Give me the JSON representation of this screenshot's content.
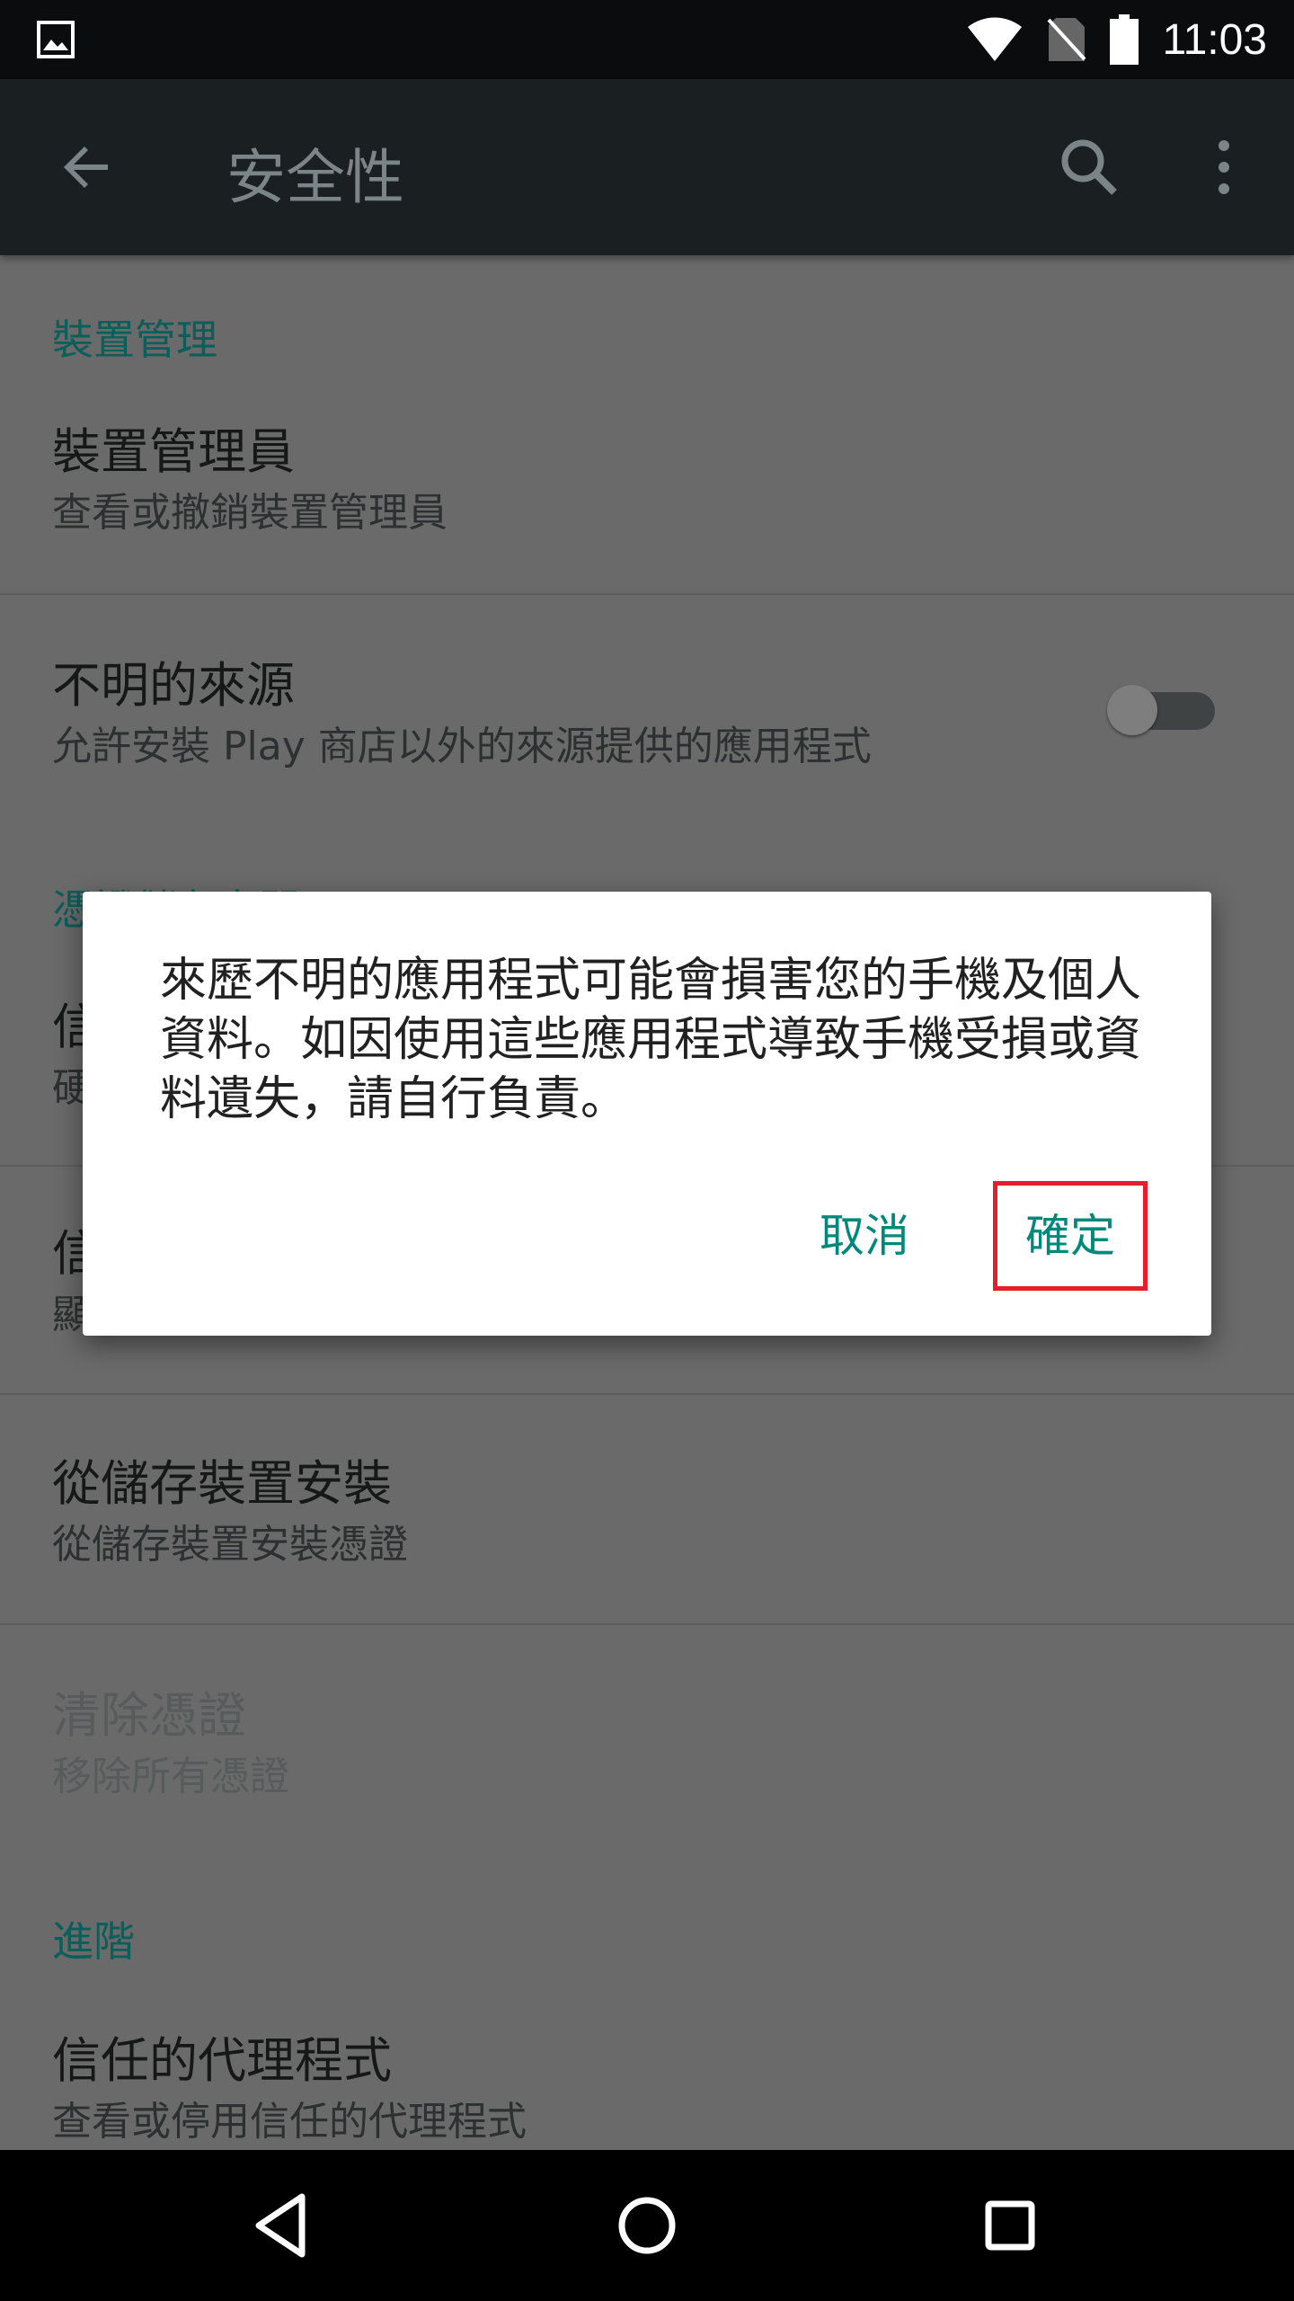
{
  "status_bar": {
    "time": "11:03",
    "icons": [
      "image-notification-icon",
      "wifi-icon",
      "no-sim-icon",
      "battery-icon"
    ]
  },
  "app_bar": {
    "title": "安全性",
    "icons": [
      "back-arrow-icon",
      "search-icon",
      "more-vert-icon"
    ]
  },
  "sections": {
    "device_admin": {
      "header": "裝置管理",
      "items": [
        {
          "title": "裝置管理員",
          "subtitle": "查看或撤銷裝置管理員"
        },
        {
          "title": "不明的來源",
          "subtitle": "允許安裝 Play 商店以外的來源提供的應用程式",
          "toggle": "off"
        }
      ]
    },
    "credential_storage": {
      "header": "憑證儲存空間",
      "header_visible_partial": "憑證儲存空間",
      "items": [
        {
          "title": "信",
          "subtitle": "硬"
        },
        {
          "title": "信",
          "subtitle": "顯"
        },
        {
          "title": "從儲存裝置安裝",
          "subtitle": "從儲存裝置安裝憑證"
        },
        {
          "title": "清除憑證",
          "subtitle": "移除所有憑證",
          "disabled": true
        }
      ]
    },
    "advanced": {
      "header": "進階",
      "items": [
        {
          "title": "信任的代理程式",
          "subtitle": "查看或停用信任的代理程式"
        }
      ]
    }
  },
  "dialog": {
    "message": "來歷不明的應用程式可能會損害您的手機及個人資料。如因使用這些應用程式導致手機受損或資料遺失，請自行負責。",
    "cancel_label": "取消",
    "ok_label": "確定",
    "highlight_color": "#e41e2a"
  },
  "nav_bar": {
    "icons": [
      "back-triangle-icon",
      "home-circle-icon",
      "recents-square-icon"
    ]
  },
  "colors": {
    "accent": "#00897b",
    "appbar": "#1a2022",
    "scrim_background": "#6a6a6a"
  }
}
